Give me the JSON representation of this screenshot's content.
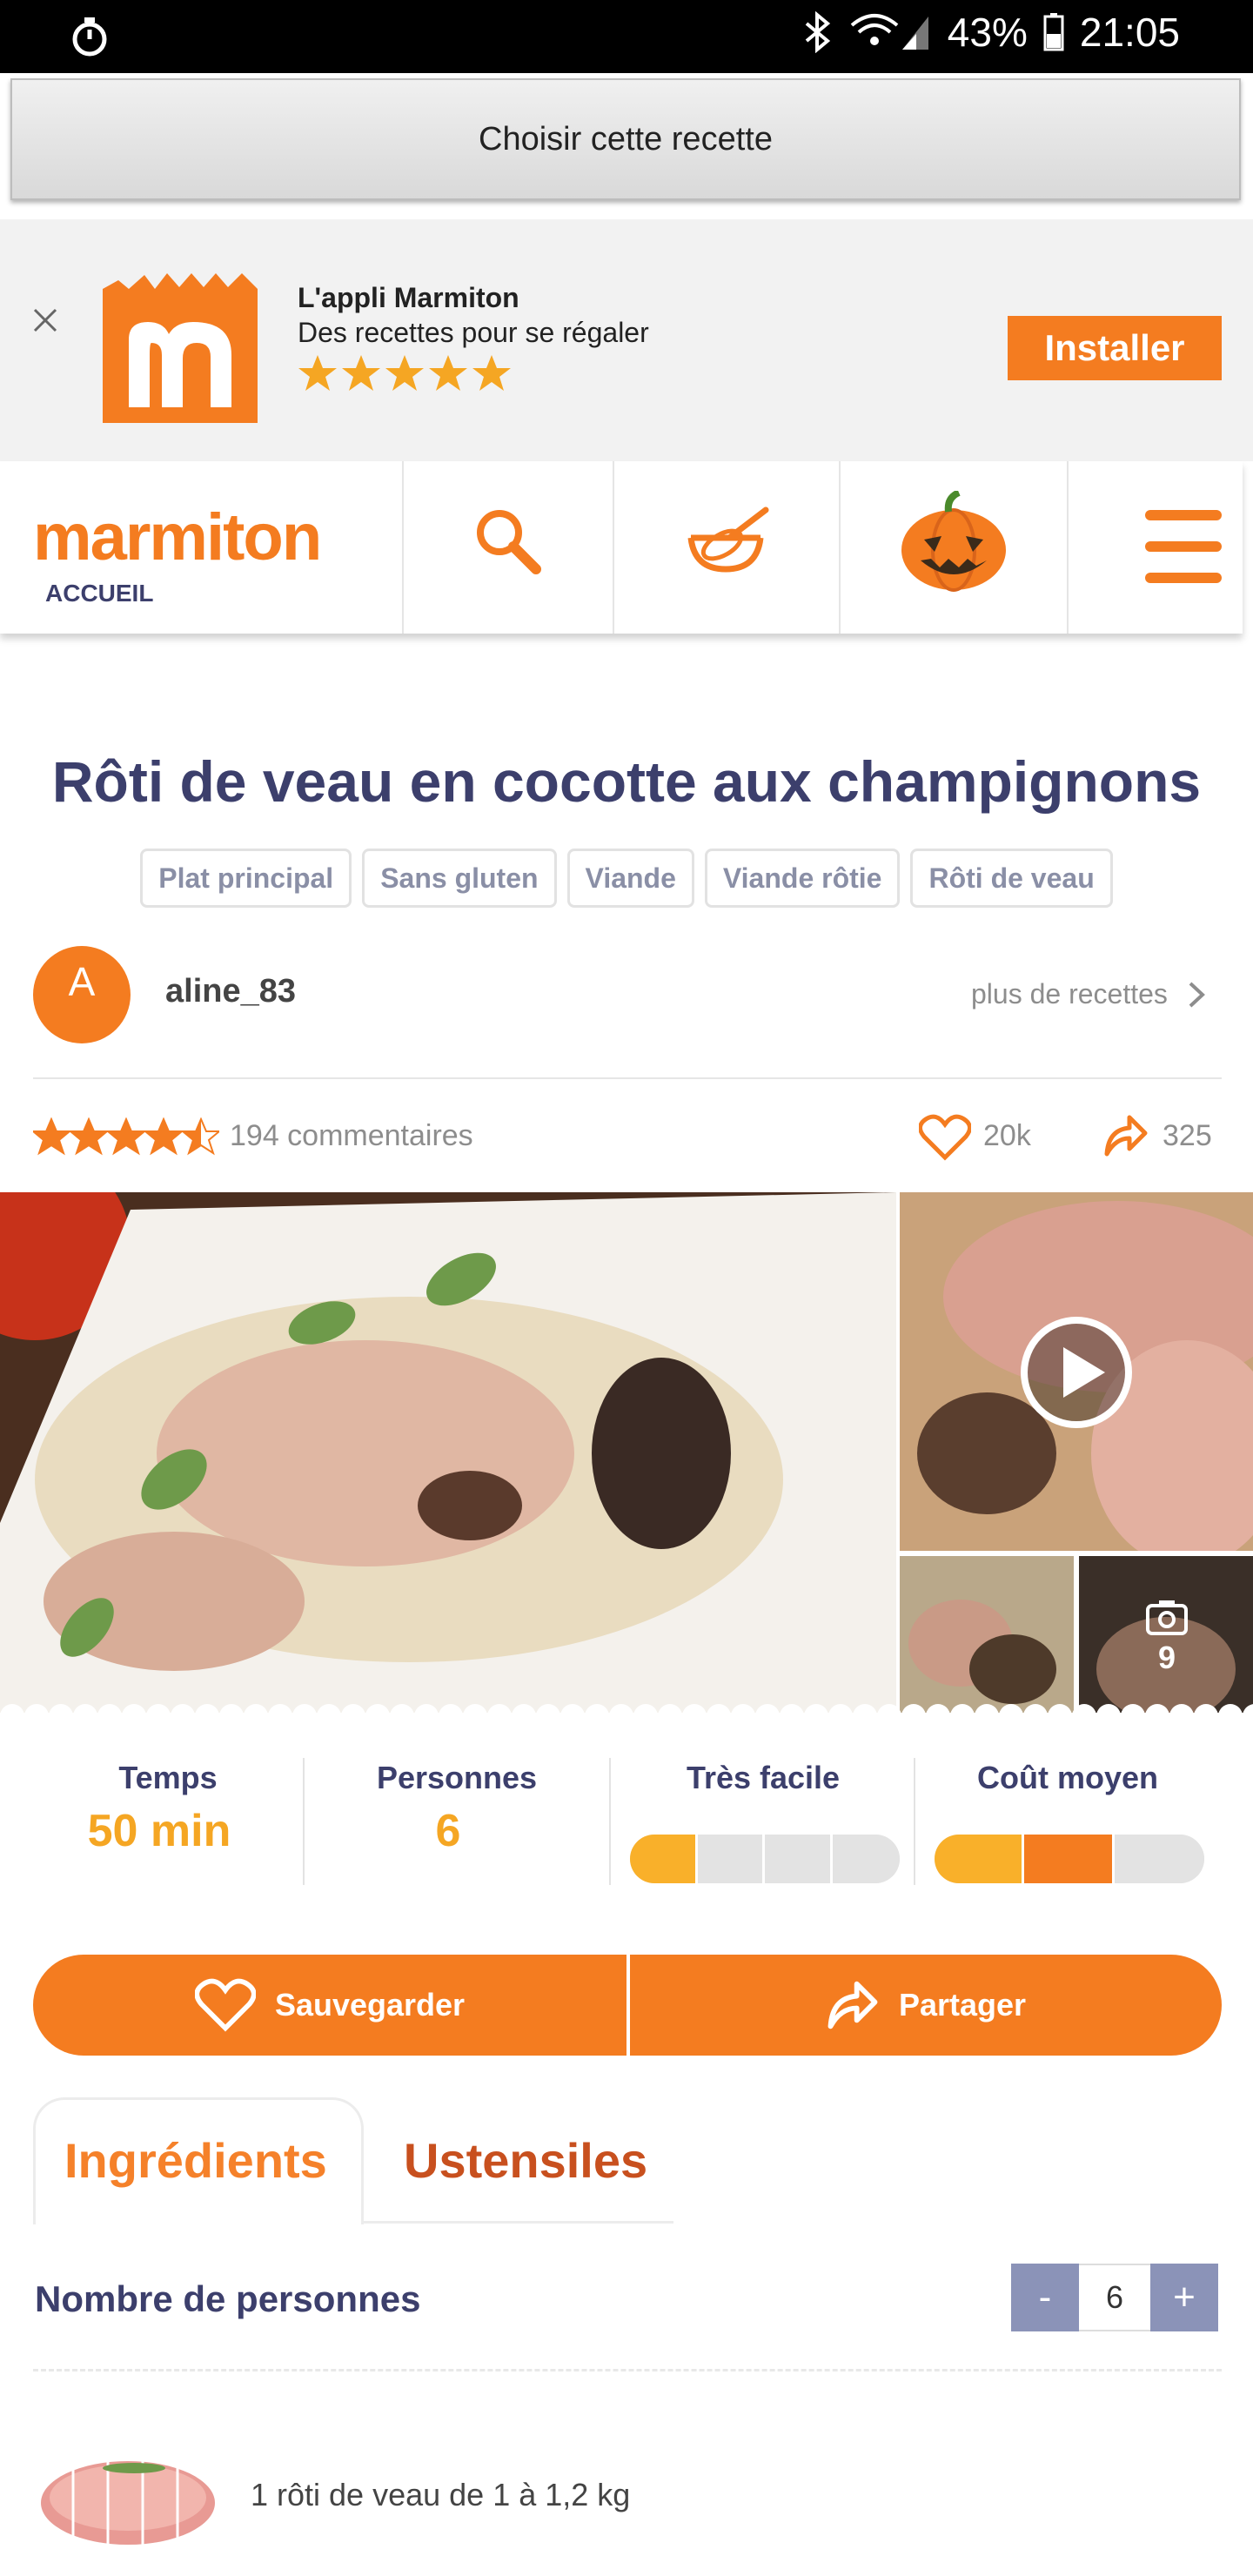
{
  "status_bar": {
    "battery": "43%",
    "time": "21:05"
  },
  "choose_button": "Choisir cette recette",
  "app_banner": {
    "title": "L'appli Marmiton",
    "subtitle": "Des recettes pour se régaler",
    "stars": 5,
    "install_label": "Installer"
  },
  "nav": {
    "logo_text": "marmiton",
    "home_label": "ACCUEIL",
    "items": [
      "search-icon",
      "whisk-bowl-icon",
      "pumpkin-icon",
      "menu-icon"
    ]
  },
  "recipe": {
    "title": "Rôti de veau en cocotte aux champignons",
    "tags": [
      "Plat principal",
      "Sans gluten",
      "Viande",
      "Viande rôtie",
      "Rôti de veau"
    ],
    "author": {
      "initial": "A",
      "name": "aline_83",
      "more_link": "plus de recettes"
    },
    "rating": 4.5,
    "comments": "194 commentaires",
    "likes": "20k",
    "shares": "325",
    "gallery": {
      "photo_count": "9"
    }
  },
  "stats": {
    "time_label": "Temps",
    "time_value": "50 min",
    "people_label": "Personnes",
    "people_value": "6",
    "difficulty_label": "Très facile",
    "difficulty_level": 1,
    "difficulty_max": 4,
    "cost_label": "Coût moyen",
    "cost_level": 2,
    "cost_max": 3
  },
  "actions": {
    "save_label": "Sauvegarder",
    "share_label": "Partager"
  },
  "tabs": {
    "ingredients": "Ingrédients",
    "utensils": "Ustensiles"
  },
  "servings": {
    "label": "Nombre de personnes",
    "minus": "-",
    "plus": "+",
    "value": "6"
  },
  "ingredients": [
    {
      "text": "1 rôti de veau de 1 à 1,2 kg"
    }
  ],
  "colors": {
    "accent": "#f47c20",
    "navy": "#3c3f6c",
    "yellow": "#f5a623"
  }
}
